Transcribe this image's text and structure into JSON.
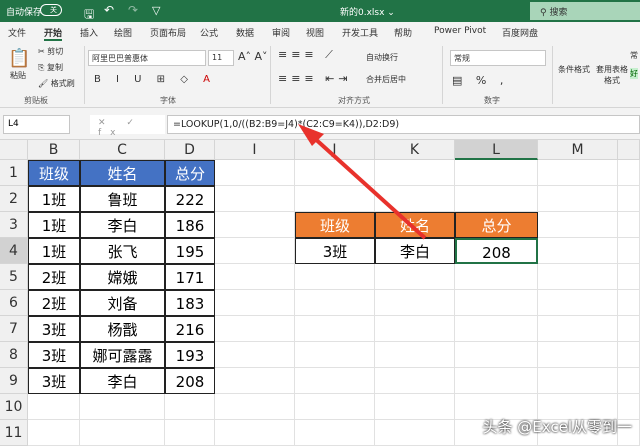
{
  "titlebar": {
    "autosave": "自动保存",
    "toggle": "关",
    "filename": "新的0.xlsx ⌄",
    "search": "搜索"
  },
  "menu": [
    "文件",
    "开始",
    "插入",
    "绘图",
    "页面布局",
    "公式",
    "数据",
    "审阅",
    "视图",
    "开发工具",
    "帮助",
    "Power Pivot",
    "百度网盘"
  ],
  "ribbon": {
    "paste": "粘贴",
    "cut": "剪切",
    "copy": "复制",
    "format_painter": "格式刷",
    "font": "阿里巴巴普惠体",
    "size": "11",
    "wrap": "自动换行",
    "merge": "合并后居中",
    "number_format": "常规",
    "cond_format": "条件格式",
    "table_format": "套用表格格式",
    "style_good": "好",
    "style_normal": "常",
    "groups": {
      "clipboard": "剪贴板",
      "font": "字体",
      "align": "对齐方式",
      "number": "数字"
    }
  },
  "formula_bar": {
    "name_box": "L4",
    "fx": "✕ ✓ fx",
    "formula": "=LOOKUP(1,0/((B2:B9=J4)*(C2:C9=K4)),D2:D9)"
  },
  "columns": [
    "B",
    "C",
    "D",
    "I",
    "J",
    "K",
    "L",
    "M"
  ],
  "rows": [
    "1",
    "2",
    "3",
    "4",
    "5",
    "6",
    "7",
    "8",
    "9",
    "10",
    "11"
  ],
  "table": {
    "headers": [
      "班级",
      "姓名",
      "总分"
    ],
    "data": [
      [
        "1班",
        "鲁班",
        "222"
      ],
      [
        "1班",
        "李白",
        "186"
      ],
      [
        "1班",
        "张飞",
        "195"
      ],
      [
        "2班",
        "嫦娥",
        "171"
      ],
      [
        "2班",
        "刘备",
        "183"
      ],
      [
        "3班",
        "杨戬",
        "216"
      ],
      [
        "3班",
        "娜可露露",
        "193"
      ],
      [
        "3班",
        "李白",
        "208"
      ]
    ]
  },
  "lookup": {
    "headers": [
      "班级",
      "姓名",
      "总分"
    ],
    "values": [
      "3班",
      "李白",
      "208"
    ]
  },
  "watermark": "头条 @Excel从零到一",
  "colors": {
    "excel_green": "#217346",
    "blue_header": "#4472c4",
    "orange_header": "#ed7d31",
    "arrow": "#e8322c"
  }
}
